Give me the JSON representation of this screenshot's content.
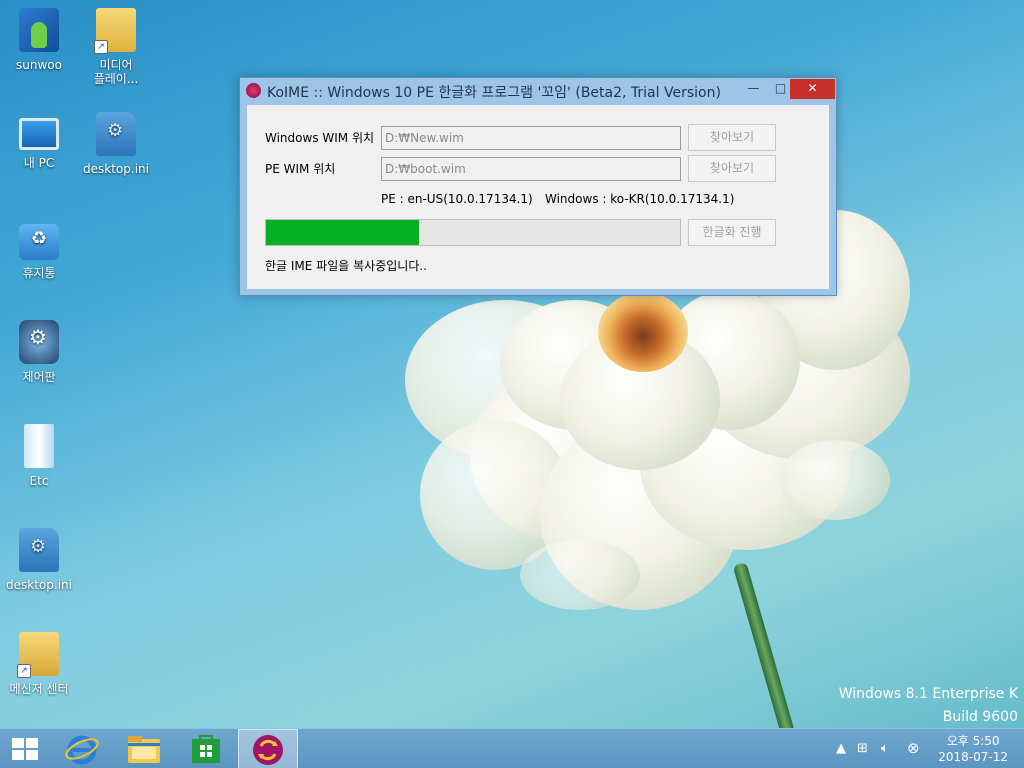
{
  "desktop": {
    "icons": [
      {
        "label": "sunwoo"
      },
      {
        "label": "미디어\n플레이..."
      },
      {
        "label": "내 PC"
      },
      {
        "label": "desktop.ini"
      },
      {
        "label": "휴지통"
      },
      {
        "label": "제어판"
      },
      {
        "label": "Etc"
      },
      {
        "label": "desktop.ini"
      },
      {
        "label": "메신저 센터"
      }
    ],
    "watermark": {
      "line1": "Windows 8.1 Enterprise K",
      "line2": "Build 9600"
    }
  },
  "dialog": {
    "title": "KoIME :: Windows 10 PE 한글화 프로그램 '꼬임' (Beta2, Trial Version)",
    "minimize": "—",
    "maximize": "□",
    "close": "✕",
    "windows_wim": {
      "label": "Windows WIM 위치",
      "value": "D:₩New.wim",
      "browse": "찾아보기"
    },
    "pe_wim": {
      "label": "PE WIM 위치",
      "value": "D:₩boot.wim",
      "browse": "찾아보기"
    },
    "pe_version": "PE : en-US(10.0.17134.1)",
    "windows_version": "Windows : ko-KR(10.0.17134.1)",
    "progress_percent": 37,
    "run_button": "한글화 진행",
    "status": "한글 IME 파일을 복사중입니다.."
  },
  "taskbar": {
    "items": [
      "start-icon",
      "internet-explorer-icon",
      "file-explorer-icon",
      "store-icon",
      "koime-icon"
    ],
    "active_item": "koime-icon",
    "clock": {
      "time": "오후 5:50",
      "date": "2018-07-12"
    }
  },
  "colors": {
    "progress_fill": "#06b025",
    "close_button": "#c7312a",
    "taskbar": "#5b95c0"
  }
}
